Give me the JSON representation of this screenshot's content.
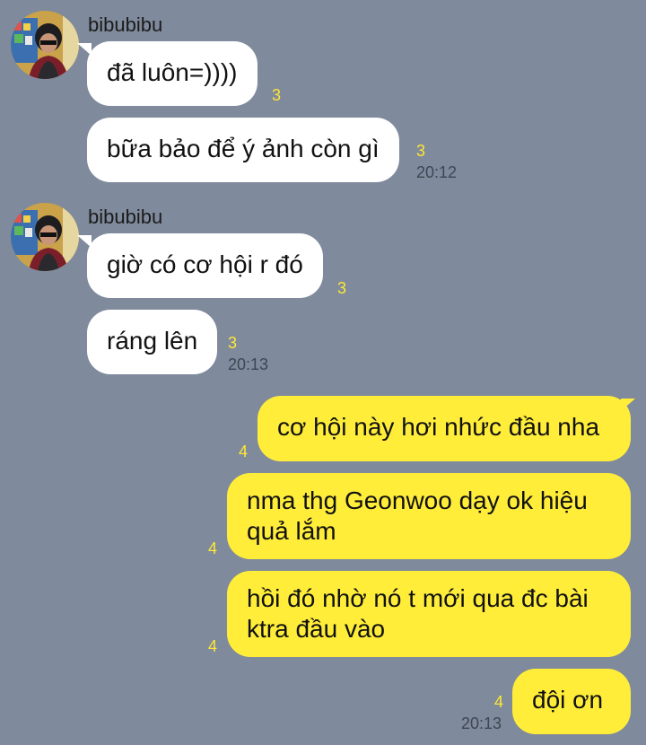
{
  "thread": {
    "groups": [
      {
        "sender": "bibubibu",
        "messages": [
          {
            "text": "đã luôn=))))",
            "unread": "3",
            "time": ""
          },
          {
            "text": "bữa bảo để ý ảnh còn gì",
            "unread": "3",
            "time": "20:12"
          }
        ]
      },
      {
        "sender": "bibubibu",
        "messages": [
          {
            "text": "giờ có cơ hội r đó",
            "unread": "3",
            "time": ""
          },
          {
            "text": "ráng lên",
            "unread": "3",
            "time": "20:13"
          }
        ]
      }
    ],
    "outgoing": [
      {
        "text": "cơ hội này hơi nhức đầu nha",
        "unread": "4",
        "time": ""
      },
      {
        "text": "nma thg Geonwoo dạy ok hiệu quả lắm",
        "unread": "4",
        "time": ""
      },
      {
        "text": "hồi đó nhờ nó t mới qua đc bài ktra đầu vào",
        "unread": "4",
        "time": ""
      },
      {
        "text": "đội ơn",
        "unread": "4",
        "time": "20:13"
      }
    ]
  },
  "colors": {
    "background": "#7f8a9c",
    "incoming_bubble": "#ffffff",
    "outgoing_bubble": "#ffed3a",
    "unread_count": "#ffe733"
  },
  "icons": {
    "avatar": "profile-photo"
  }
}
